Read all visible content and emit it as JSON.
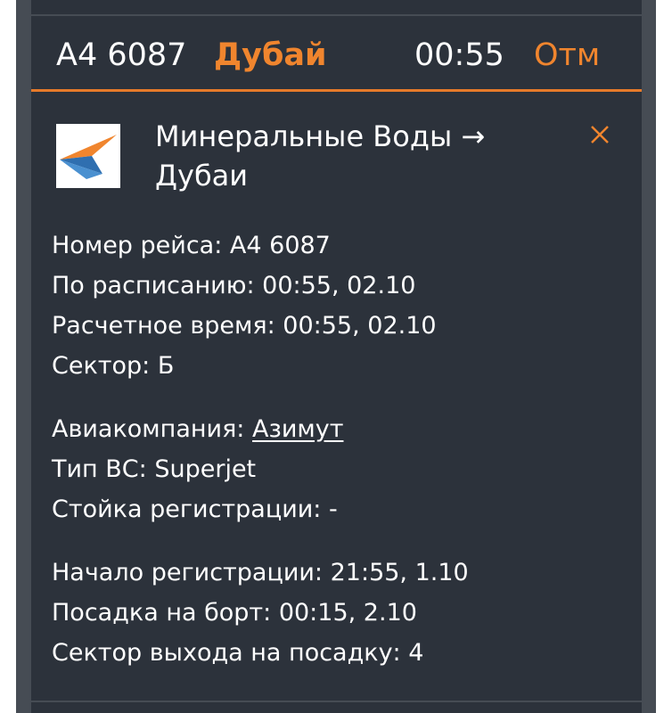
{
  "header": {
    "flight_number": "A4 6087",
    "destination": "Дубай",
    "time": "00:55",
    "status": "Отм"
  },
  "details_card": {
    "route": "Минеральные Воды → Дубаи",
    "fields": {
      "flight_number": {
        "label": "Номер рейса:",
        "value": "A4 6087"
      },
      "scheduled": {
        "label": "По расписанию:",
        "value": "00:55, 02.10"
      },
      "estimated": {
        "label": "Расчетное время:",
        "value": "00:55, 02.10"
      },
      "sector": {
        "label": "Сектор:",
        "value": "Б"
      },
      "airline": {
        "label": "Авиакомпания:",
        "value": "Азимут"
      },
      "aircraft": {
        "label": "Тип ВС:",
        "value": "Superjet"
      },
      "checkin_desk": {
        "label": "Стойка регистрации:",
        "value": "-"
      },
      "checkin_start": {
        "label": "Начало регистрации:",
        "value": "21:55, 1.10"
      },
      "boarding": {
        "label": "Посадка на борт:",
        "value": "00:15, 2.10"
      },
      "gate_sector": {
        "label": "Сектор выхода на посадку:",
        "value": "4"
      }
    }
  },
  "icons": {
    "airline_logo": "azimuth-logo-icon",
    "close": "close-icon"
  },
  "colors": {
    "accent": "#f0852e",
    "panel_bg": "#2c323b",
    "frame_bg": "#464c54",
    "text": "#ffffff"
  }
}
